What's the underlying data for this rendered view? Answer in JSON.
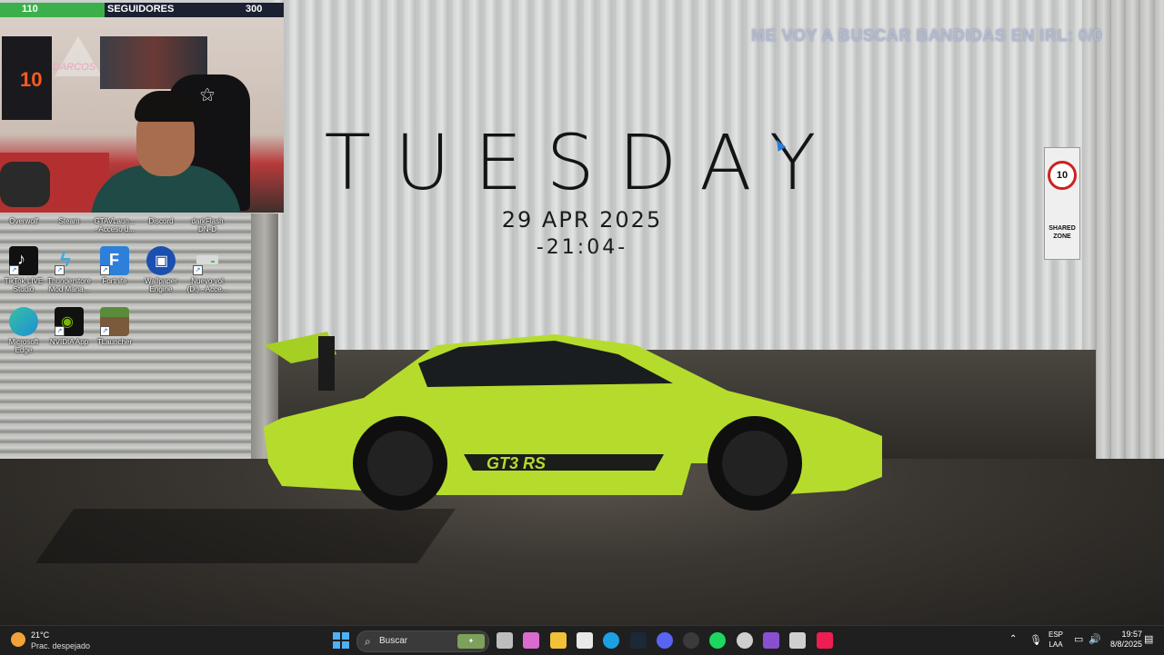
{
  "followers_bar": {
    "left_value": "110",
    "label": "SEGUIDORES",
    "right_value": "300",
    "progress": 0.37,
    "fill_color": "#3bb04a"
  },
  "overlay_goal": "ME VOY A BUSCAR BANDIDAS EN IRL: 0/0",
  "widget_clock": {
    "day": "TUESDAY",
    "date": "29 APR 2025",
    "time": "-21:04-"
  },
  "webcam": {
    "neon_sign": "DARCOS",
    "poster_number": "10"
  },
  "street_sign": {
    "number": "10",
    "text": "SHARED ZONE"
  },
  "desktop_icons": {
    "row1": [
      {
        "label": "Overwolf"
      },
      {
        "label": "Steam"
      },
      {
        "label": "GTAVLaun...\n- Acceso d..."
      },
      {
        "label": "Discord"
      },
      {
        "label": "darkFlash\nDN-D"
      }
    ],
    "row2": [
      {
        "label": "TikTok LIVE\nStudio",
        "icon": "tiktok-icon",
        "color": "#111111"
      },
      {
        "label": "Thunderstore\nMod Mana...",
        "icon": "thunderstore-icon",
        "color": "#2f8dbe"
      },
      {
        "label": "Fortnite",
        "icon": "fortnite-icon",
        "color": "#2d7fd9"
      },
      {
        "label": "Wallpaper\nEngine",
        "icon": "wallpaper-engine-icon",
        "color": "#1b4fb0"
      },
      {
        "label": "Nuevo vol\n(D:) - Acce...",
        "icon": "drive-icon",
        "color": "#dadada"
      }
    ],
    "row3": [
      {
        "label": "Microsoft\nEdge",
        "icon": "edge-icon",
        "color": "#1e8fd6"
      },
      {
        "label": "NVIDIA App",
        "icon": "nvidia-icon",
        "color": "#111111"
      },
      {
        "label": "TLauncher",
        "icon": "tlauncher-icon",
        "color": "#5a8b3a"
      }
    ]
  },
  "taskbar": {
    "weather": {
      "temp": "21°C",
      "condition": "Prac. despejado"
    },
    "search": {
      "placeholder": "Buscar"
    },
    "lang": {
      "line1": "ESP",
      "line2": "LAA"
    },
    "clock": {
      "time": "19:57",
      "date": "8/8/2025"
    },
    "apps": [
      {
        "name": "task-view-icon",
        "color": "#bdbdbd"
      },
      {
        "name": "copilot-icon",
        "color": "#d96bd0"
      },
      {
        "name": "file-explorer-icon",
        "color": "#f2c13a"
      },
      {
        "name": "microsoft-store-icon",
        "color": "#e8e8e8"
      },
      {
        "name": "edge-icon",
        "color": "#1ba1e2"
      },
      {
        "name": "steam-icon",
        "color": "#1b2838"
      },
      {
        "name": "discord-icon",
        "color": "#5865f2"
      },
      {
        "name": "obs-icon",
        "color": "#3a3a3a"
      },
      {
        "name": "spotify-icon",
        "color": "#1ed760"
      },
      {
        "name": "settings-icon",
        "color": "#cfcfcf"
      },
      {
        "name": "app-icon",
        "color": "#8a4fd0"
      },
      {
        "name": "keyboard-icon",
        "color": "#cfcfcf"
      },
      {
        "name": "tiktok-icon",
        "color": "#ee1d52"
      }
    ]
  }
}
